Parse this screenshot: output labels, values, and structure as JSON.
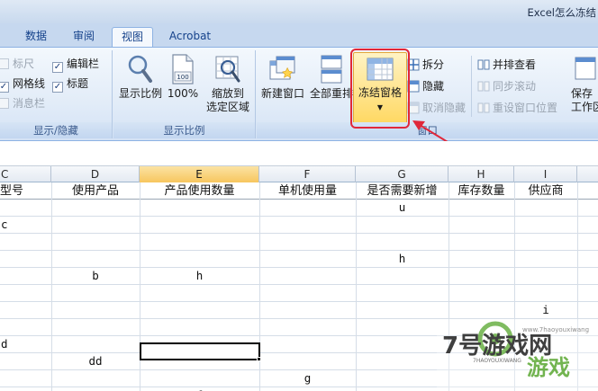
{
  "window": {
    "title": "Excel怎么冻结"
  },
  "tabs": [
    {
      "label": "数据",
      "active": false
    },
    {
      "label": "审阅",
      "active": false
    },
    {
      "label": "视图",
      "active": true
    },
    {
      "label": "Acrobat",
      "active": false
    }
  ],
  "ribbon": {
    "show_hide": {
      "label": "显示/隐藏",
      "ruler": {
        "label": "标尺",
        "checked": false,
        "enabled": false
      },
      "formula_bar": {
        "label": "编辑栏",
        "checked": true,
        "enabled": true
      },
      "gridlines": {
        "label": "网格线",
        "checked": true,
        "enabled": true
      },
      "headings": {
        "label": "标题",
        "checked": true,
        "enabled": true
      },
      "message_bar": {
        "label": "消息栏",
        "checked": false,
        "enabled": false
      }
    },
    "zoom": {
      "label": "显示比例",
      "zoom_button": "显示比例",
      "zoom100_button": "100%",
      "zoom_selection_line1": "缩放到",
      "zoom_selection_line2": "选定区域",
      "zoom100_icon_text": "100"
    },
    "window": {
      "label": "窗口",
      "new_window": "新建窗口",
      "arrange_all": "全部重排",
      "freeze_panes": "冻结窗格",
      "split": "拆分",
      "hide": "隐藏",
      "unhide": "取消隐藏",
      "side_by_side": "并排查看",
      "sync_scroll": "同步滚动",
      "reset_position": "重设窗口位置",
      "save_line1": "保存",
      "save_line2": "工作区"
    }
  },
  "sheet": {
    "columns": [
      "C",
      "D",
      "E",
      "F",
      "G",
      "H",
      "I"
    ],
    "active_column": "E",
    "header_row": [
      "型号",
      "使用产品",
      "产品使用数量",
      "单机使用量",
      "是否需要新增",
      "库存数量",
      "供应商"
    ],
    "cells": [
      {
        "col": "G",
        "row": 1,
        "value": "u"
      },
      {
        "col": "C",
        "row": 2,
        "value": "c"
      },
      {
        "col": "G",
        "row": 4,
        "value": "h"
      },
      {
        "col": "D",
        "row": 5,
        "value": "b"
      },
      {
        "col": "E",
        "row": 5,
        "value": "h"
      },
      {
        "col": "I",
        "row": 7,
        "value": "i"
      },
      {
        "col": "C",
        "row": 9,
        "value": "d"
      },
      {
        "col": "D",
        "row": 10,
        "value": "dd"
      },
      {
        "col": "F",
        "row": 11,
        "value": "g"
      },
      {
        "col": "E",
        "row": 12,
        "value": "f"
      }
    ],
    "selected_cell": {
      "col": "E",
      "row": 10
    }
  },
  "annotation": {
    "color": "#e0283a"
  },
  "watermark": {
    "brand": "7号游戏网",
    "domain": "www.7haoyouxiwang",
    "pinyin": "7HAOYOUXIWANG",
    "big": "游戏"
  }
}
